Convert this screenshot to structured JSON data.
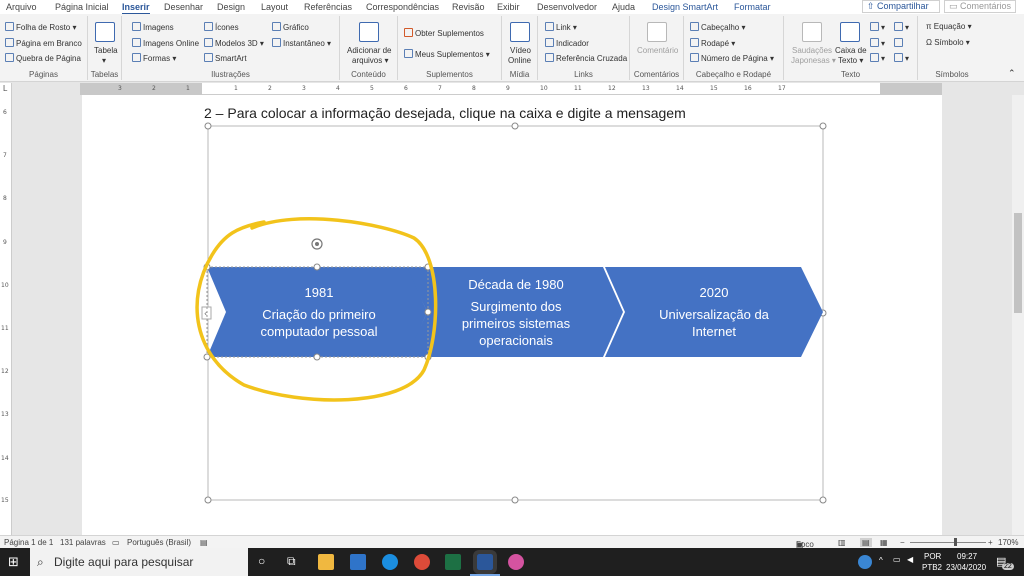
{
  "menu": {
    "tabs": [
      "Arquivo",
      "Página Inicial",
      "Inserir",
      "Desenhar",
      "Design",
      "Layout",
      "Referências",
      "Correspondências",
      "Revisão",
      "Exibir",
      "Desenvolvedor",
      "Ajuda",
      "Design SmartArt",
      "Formatar"
    ],
    "active_tab": "Inserir",
    "share": "Compartilhar",
    "comments": "Comentários"
  },
  "ribbon": {
    "paginas": {
      "label": "Páginas",
      "items": [
        "Folha de Rosto",
        "Página em Branco",
        "Quebra de Página"
      ]
    },
    "tabelas": {
      "label": "Tabelas",
      "item": "Tabela"
    },
    "ilustracoes": {
      "label": "Ilustrações",
      "items": [
        "Imagens",
        "Imagens Online",
        "Formas",
        "Ícones",
        "Modelos 3D",
        "SmartArt",
        "Gráfico",
        "Instantâneo"
      ]
    },
    "conteudo": {
      "label": "Conteúdo",
      "item1": "Adicionar de",
      "item2": "arquivos"
    },
    "suplementos": {
      "label": "Suplementos",
      "items": [
        "Obter Suplementos",
        "Meus Suplementos"
      ]
    },
    "midia": {
      "label": "Mídia",
      "item1": "Vídeo",
      "item2": "Online"
    },
    "links": {
      "label": "Links",
      "items": [
        "Link",
        "Indicador",
        "Referência Cruzada"
      ]
    },
    "comentarios": {
      "label": "Comentários",
      "item": "Comentário"
    },
    "cabecalho": {
      "label": "Cabeçalho e Rodapé",
      "items": [
        "Cabeçalho",
        "Rodapé",
        "Número de Página"
      ]
    },
    "texto": {
      "label": "Texto",
      "saud1": "Saudações",
      "saud2": "Japonesas",
      "caixa1": "Caixa de",
      "caixa2": "Texto"
    },
    "simbolos": {
      "label": "Símbolos",
      "items": [
        "Equação",
        "Símbolo"
      ]
    }
  },
  "ruler": {
    "h_ticks": [
      "3",
      "2",
      "1",
      "1",
      "2",
      "3",
      "4",
      "5",
      "6",
      "7",
      "8",
      "9",
      "10",
      "11",
      "12",
      "13",
      "14",
      "15",
      "16",
      "17"
    ],
    "v_ticks": [
      "6",
      "7",
      "8",
      "9",
      "10",
      "11",
      "12",
      "13",
      "14",
      "15"
    ]
  },
  "document": {
    "instruction": "2 – Para colocar a informação desejada, clique na caixa e digite a mensagem"
  },
  "smartart": {
    "items": [
      {
        "year": "1981",
        "line1": "Criação do primeiro",
        "line2": "computador pessoal"
      },
      {
        "year": "Década de 1980",
        "line1": "Surgimento dos",
        "line2": "primeiros sistemas",
        "line3": "operacionais"
      },
      {
        "year": "2020",
        "line1": "Universalização da",
        "line2": "Internet"
      }
    ],
    "fill_color": "#4472c4",
    "highlight_color": "#f2c31b"
  },
  "status": {
    "page": "Página 1 de 1",
    "words": "131 palavras",
    "language": "Português (Brasil)",
    "focus": "Foco",
    "zoom": "170%"
  },
  "taskbar": {
    "search_placeholder": "Digite aqui para pesquisar",
    "lang1": "POR",
    "lang2": "PTB2",
    "time": "09:27",
    "date": "23/04/2020",
    "notif_count": "22"
  }
}
